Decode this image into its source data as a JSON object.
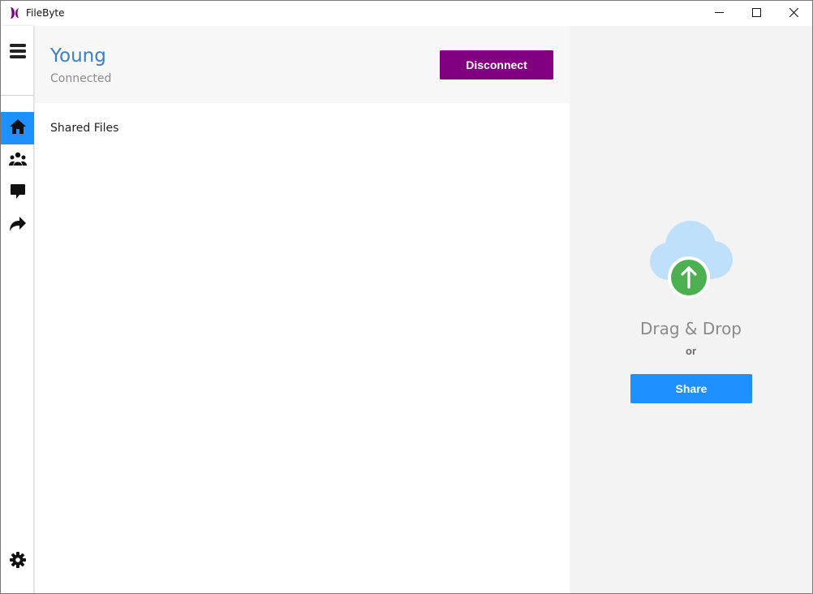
{
  "app": {
    "title": "FileByte",
    "brand_color": "#800080",
    "accent_color": "#1e90ff"
  },
  "window_controls": {
    "minimize_icon": "minimize-icon",
    "maximize_icon": "maximize-icon",
    "close_icon": "close-icon"
  },
  "sidebar": {
    "menu_icon": "hamburger-menu-icon",
    "items": [
      {
        "icon": "home-icon",
        "active": true
      },
      {
        "icon": "people-icon",
        "active": false
      },
      {
        "icon": "chat-icon",
        "active": false
      },
      {
        "icon": "share-arrow-icon",
        "active": false
      }
    ],
    "settings_icon": "gear-icon"
  },
  "header": {
    "peer_name": "Young",
    "status": "Connected",
    "disconnect_label": "Disconnect"
  },
  "main": {
    "section_title": "Shared Files"
  },
  "drop_panel": {
    "icon": "cloud-upload-icon",
    "drag_drop_text": "Drag & Drop",
    "or_text": "or",
    "share_label": "Share"
  }
}
